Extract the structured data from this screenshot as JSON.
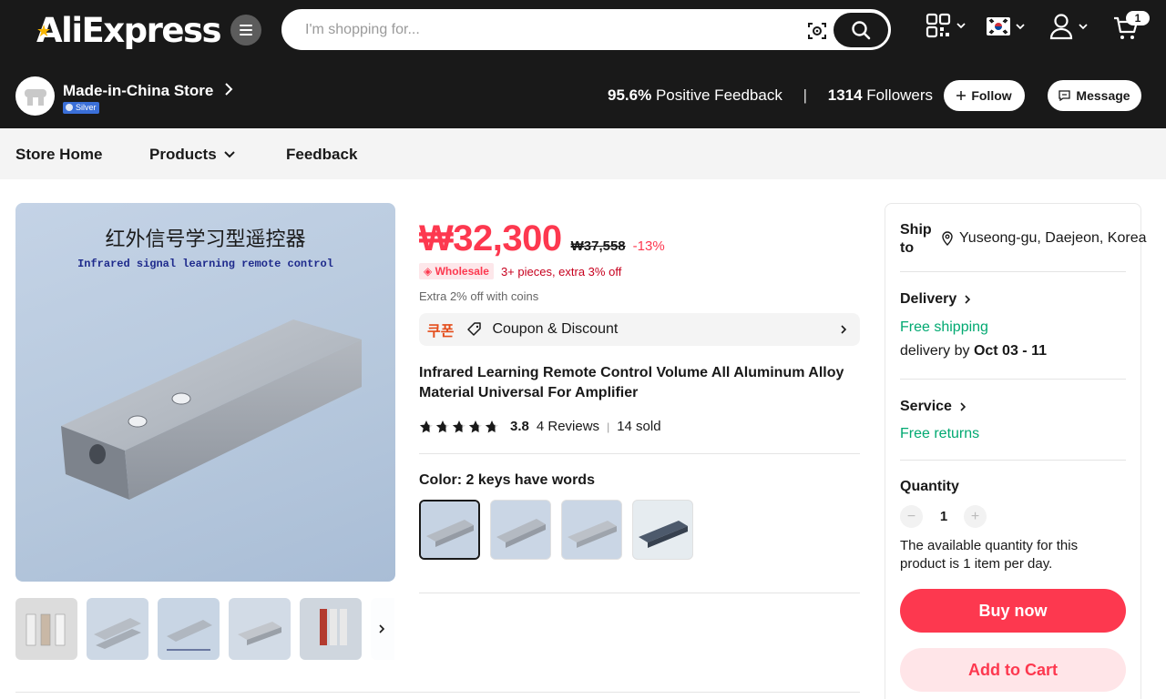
{
  "header": {
    "logo": "AliExpress",
    "search_placeholder": "I'm shopping for...",
    "cart_count": "1",
    "icons": [
      "menu-icon",
      "camera-search-icon",
      "search-icon",
      "qr-code-icon",
      "flag-korea-icon",
      "account-icon",
      "cart-icon"
    ]
  },
  "store": {
    "name": "Made-in-China Store",
    "badge": "Silver",
    "positive_feedback_value": "95.6%",
    "positive_feedback_label": "Positive Feedback",
    "followers_value": "1314",
    "followers_label": "Followers",
    "follow_label": "Follow",
    "message_label": "Message"
  },
  "nav": {
    "items": [
      {
        "label": "Store Home"
      },
      {
        "label": "Products"
      },
      {
        "label": "Feedback"
      }
    ]
  },
  "gallery": {
    "image_title_cn": "红外信号学习型遥控器",
    "image_title_en": "Infrared signal learning remote control",
    "thumb_count": 6
  },
  "product": {
    "price": "₩32,300",
    "original_price": "₩37,558",
    "discount": "-13%",
    "wholesale_tag": "Wholesale",
    "wholesale_text": "3+ pieces, extra 3% off",
    "coins_text": "Extra 2% off with coins",
    "coupon_kr": "쿠폰",
    "coupon_label": "Coupon & Discount",
    "title": "Infrared Learning Remote Control Volume All Aluminum Alloy Material Universal For Amplifier",
    "rating": "3.8",
    "rating_fraction": 0.76,
    "reviews": "4 Reviews",
    "sold": "14 sold",
    "color_label": "Color: 2 keys have words",
    "swatch_count": 4,
    "selected_swatch": 0
  },
  "panel": {
    "ship_label": "Ship to",
    "ship_location": "Yuseong-gu, Daejeon, Korea",
    "delivery_label": "Delivery",
    "free_shipping": "Free shipping",
    "delivery_prefix": "delivery by",
    "delivery_dates": "Oct 03 - 11",
    "service_label": "Service",
    "free_returns": "Free returns",
    "quantity_label": "Quantity",
    "quantity_value": "1",
    "quantity_note": "The available quantity for this product is 1 item per day.",
    "buy_now": "Buy now",
    "add_to_cart": "Add to Cart"
  },
  "colors": {
    "header_bg": "#191919",
    "accent_red": "#fd384f",
    "green": "#01a971"
  }
}
